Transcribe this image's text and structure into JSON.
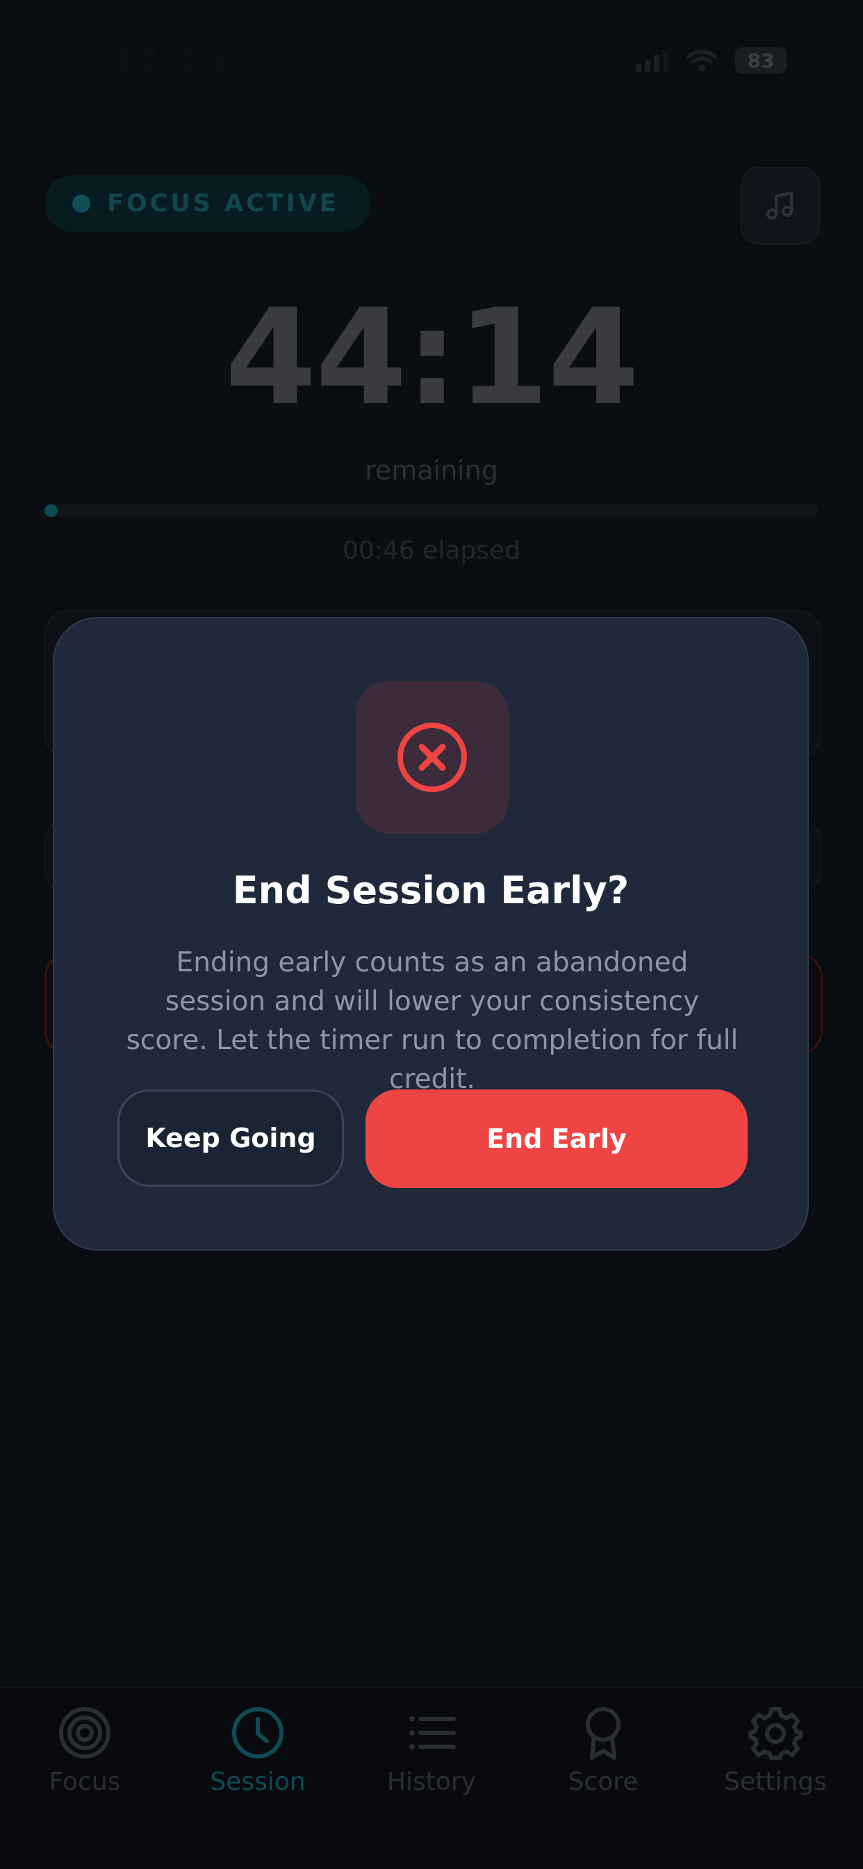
{
  "status_bar": {
    "time": "14:15",
    "battery": "83"
  },
  "session": {
    "badge": "FOCUS ACTIVE",
    "timer": "44:14",
    "remaining_label": "remaining",
    "elapsed_label": "00:46 elapsed",
    "progress_fraction": 0.017
  },
  "modal": {
    "title": "End Session Early?",
    "description": "Ending early counts as an abandoned session and will lower your consistency score. Let the timer run to completion for full credit.",
    "keep_label": "Keep Going",
    "end_label": "End Early",
    "icon": "x-circle-icon"
  },
  "tabs": [
    {
      "label": "Focus",
      "icon": "target-icon",
      "active": false
    },
    {
      "label": "Session",
      "icon": "clock-icon",
      "active": true
    },
    {
      "label": "History",
      "icon": "list-icon",
      "active": false
    },
    {
      "label": "Score",
      "icon": "award-icon",
      "active": false
    },
    {
      "label": "Settings",
      "icon": "gear-icon",
      "active": false
    }
  ],
  "colors": {
    "accent": "#0f4b54",
    "danger": "#ef4444",
    "modal_bg": "#1f293a"
  }
}
